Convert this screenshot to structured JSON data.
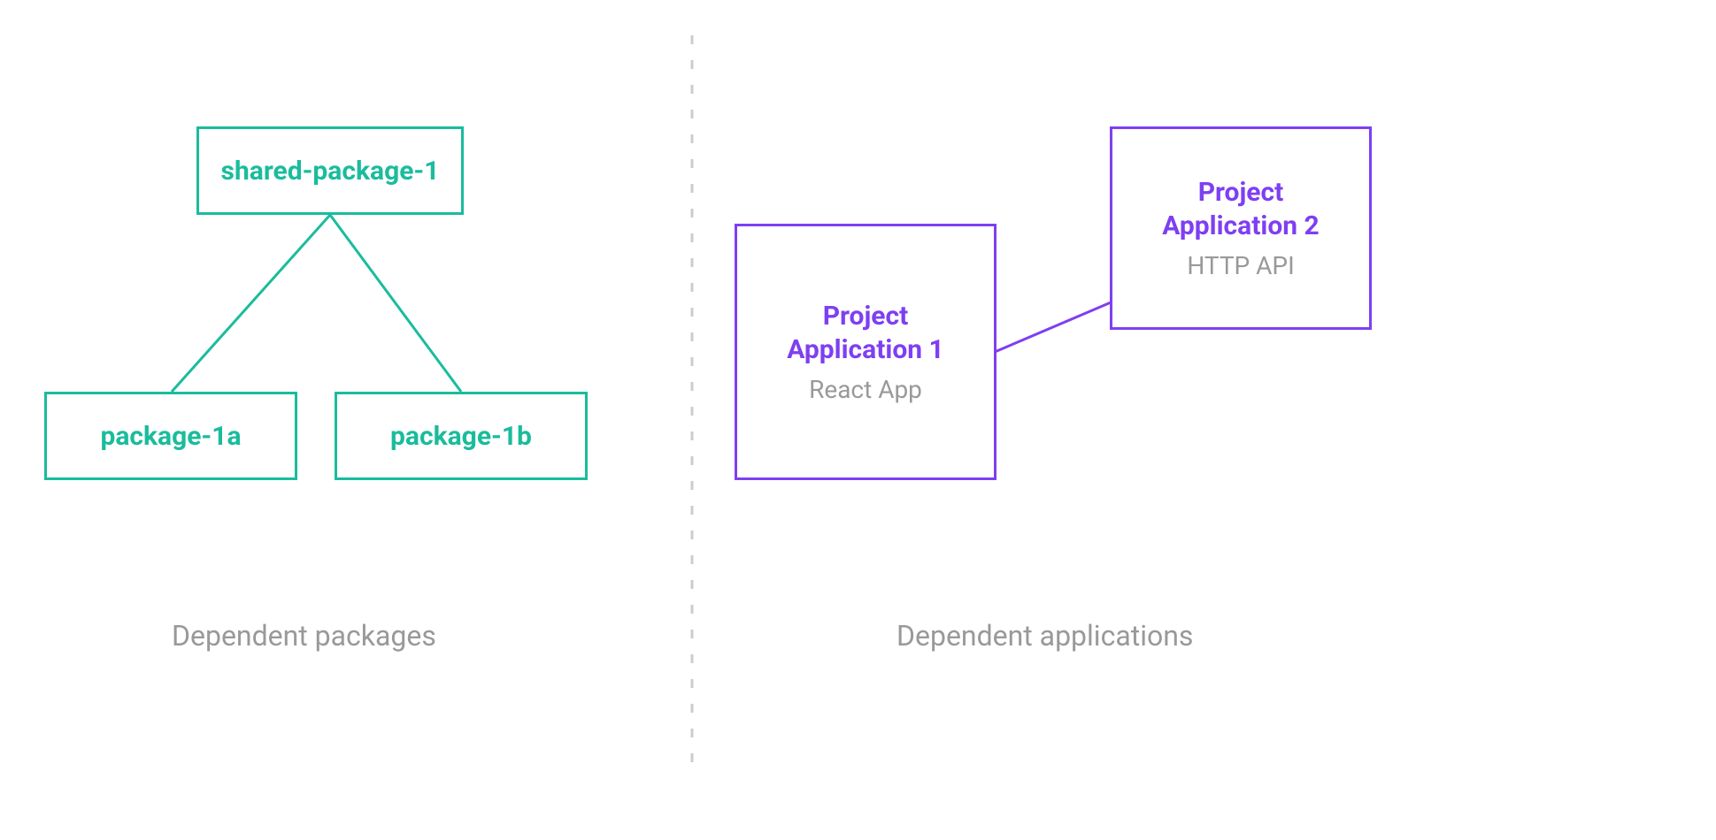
{
  "leftSection": {
    "parentBox": {
      "label": "shared-package-1"
    },
    "childBoxA": {
      "label": "package-1a"
    },
    "childBoxB": {
      "label": "package-1b"
    },
    "caption": "Dependent packages"
  },
  "rightSection": {
    "appBox1": {
      "titleLine1": "Project",
      "titleLine2": "Application 1",
      "subtitle": "React App"
    },
    "appBox2": {
      "titleLine1": "Project",
      "titleLine2": "Application 2",
      "subtitle": "HTTP API"
    },
    "caption": "Dependent applications"
  }
}
